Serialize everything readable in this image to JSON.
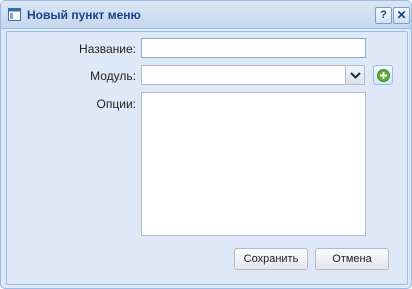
{
  "window": {
    "title": "Новый пункт меню",
    "help_label": "?",
    "close_label": "✕"
  },
  "form": {
    "name_label": "Название:",
    "name_value": "",
    "module_label": "Модуль:",
    "module_value": "",
    "options_label": "Опции:",
    "options_value": ""
  },
  "buttons": {
    "save_label": "Сохранить",
    "cancel_label": "Отмена"
  },
  "icons": {
    "window": "window-icon",
    "dropdown": "chevron-down-icon",
    "add": "add-circle-icon"
  },
  "colors": {
    "title_text": "#15428b",
    "panel_bg": "#dfe8f6",
    "border": "#99bbe8",
    "add_icon": "#4a9a2f"
  }
}
